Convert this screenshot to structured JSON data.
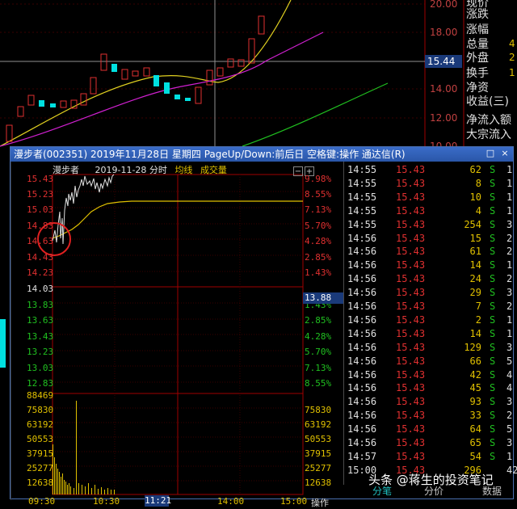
{
  "background": {
    "price_axis": [
      "20.00",
      "18.00",
      "16.00",
      "14.00",
      "12.00",
      "10.00"
    ],
    "crosshair_price": "15.44",
    "right_panel": [
      {
        "label": "现价",
        "value": ""
      },
      {
        "label": "涨跌",
        "value": ""
      },
      {
        "label": "涨幅",
        "value": ""
      },
      {
        "label": "总量",
        "value": "4"
      },
      {
        "label": "外盘",
        "value": "2"
      },
      {
        "label": "换手",
        "value": "1"
      },
      {
        "label": "净资",
        "value": ""
      },
      {
        "label": "收益(三)",
        "value": ""
      },
      {
        "label": "净流入额",
        "value": ""
      },
      {
        "label": "大宗流入",
        "value": ""
      }
    ]
  },
  "popup": {
    "title": "漫步者(002351) 2019年11月28日 星期四 PageUp/Down:前后日 空格键:操作 通达信(R)",
    "restore_label": "□",
    "close_label": "×",
    "header": {
      "name": "漫步者",
      "date": "2019-11-28 分时",
      "avg_label": "均线",
      "vol_label": "成交量"
    },
    "price_left": [
      "15.43",
      "15.23",
      "15.03",
      "14.83",
      "14.63",
      "14.43",
      "14.23",
      "14.03",
      "13.83",
      "13.63",
      "13.43",
      "13.23",
      "13.03",
      "12.83"
    ],
    "pct_right": [
      "9.98%",
      "8.55%",
      "7.13%",
      "5.70%",
      "4.28%",
      "2.85%",
      "1.43%",
      "",
      "1.43%",
      "2.85%",
      "4.28%",
      "5.70%",
      "7.13%",
      "8.55%"
    ],
    "current_price_tag": "13.88",
    "volume_axis": [
      "88469",
      "75830",
      "63192",
      "50553",
      "37915",
      "25277",
      "12638"
    ],
    "time_axis": [
      "09:30",
      "10:30",
      "14:00",
      "15:00"
    ],
    "time_tag": "11:21",
    "ops_label": "操作",
    "trades": [
      {
        "time": "14:55",
        "price": "15.43",
        "vol": "62",
        "side": "S",
        "cnt": "1"
      },
      {
        "time": "14:55",
        "price": "15.43",
        "vol": "8",
        "side": "S",
        "cnt": "1"
      },
      {
        "time": "14:55",
        "price": "15.43",
        "vol": "10",
        "side": "S",
        "cnt": "1"
      },
      {
        "time": "14:55",
        "price": "15.43",
        "vol": "4",
        "side": "S",
        "cnt": "1"
      },
      {
        "time": "14:55",
        "price": "15.43",
        "vol": "254",
        "side": "S",
        "cnt": "3"
      },
      {
        "time": "14:56",
        "price": "15.43",
        "vol": "15",
        "side": "S",
        "cnt": "2"
      },
      {
        "time": "14:56",
        "price": "15.43",
        "vol": "61",
        "side": "S",
        "cnt": "2"
      },
      {
        "time": "14:56",
        "price": "15.43",
        "vol": "14",
        "side": "S",
        "cnt": "1"
      },
      {
        "time": "14:56",
        "price": "15.43",
        "vol": "24",
        "side": "S",
        "cnt": "2"
      },
      {
        "time": "14:56",
        "price": "15.43",
        "vol": "29",
        "side": "S",
        "cnt": "3"
      },
      {
        "time": "14:56",
        "price": "15.43",
        "vol": "7",
        "side": "S",
        "cnt": "2"
      },
      {
        "time": "14:56",
        "price": "15.43",
        "vol": "2",
        "side": "S",
        "cnt": "1"
      },
      {
        "time": "14:56",
        "price": "15.43",
        "vol": "14",
        "side": "S",
        "cnt": "1"
      },
      {
        "time": "14:56",
        "price": "15.43",
        "vol": "129",
        "side": "S",
        "cnt": "3"
      },
      {
        "time": "14:56",
        "price": "15.43",
        "vol": "66",
        "side": "S",
        "cnt": "5"
      },
      {
        "time": "14:56",
        "price": "15.43",
        "vol": "42",
        "side": "S",
        "cnt": "4"
      },
      {
        "time": "14:56",
        "price": "15.43",
        "vol": "45",
        "side": "S",
        "cnt": "4"
      },
      {
        "time": "14:56",
        "price": "15.43",
        "vol": "93",
        "side": "S",
        "cnt": "3"
      },
      {
        "time": "14:56",
        "price": "15.43",
        "vol": "33",
        "side": "S",
        "cnt": "2"
      },
      {
        "time": "14:56",
        "price": "15.43",
        "vol": "64",
        "side": "S",
        "cnt": "5"
      },
      {
        "time": "14:56",
        "price": "15.43",
        "vol": "65",
        "side": "S",
        "cnt": "3"
      },
      {
        "time": "14:57",
        "price": "15.43",
        "vol": "54",
        "side": "S",
        "cnt": "1"
      },
      {
        "time": "15:00",
        "price": "15.43",
        "vol": "296",
        "side": "",
        "cnt": "42"
      }
    ],
    "footer_tabs": [
      "分笔",
      "分价",
      "数据"
    ]
  },
  "watermark": "头条 @蒋生的投资笔记",
  "colors": {
    "up": "#e03030",
    "down": "#20c020",
    "avg": "#e0c000",
    "title_bar": "#2a56a8"
  }
}
